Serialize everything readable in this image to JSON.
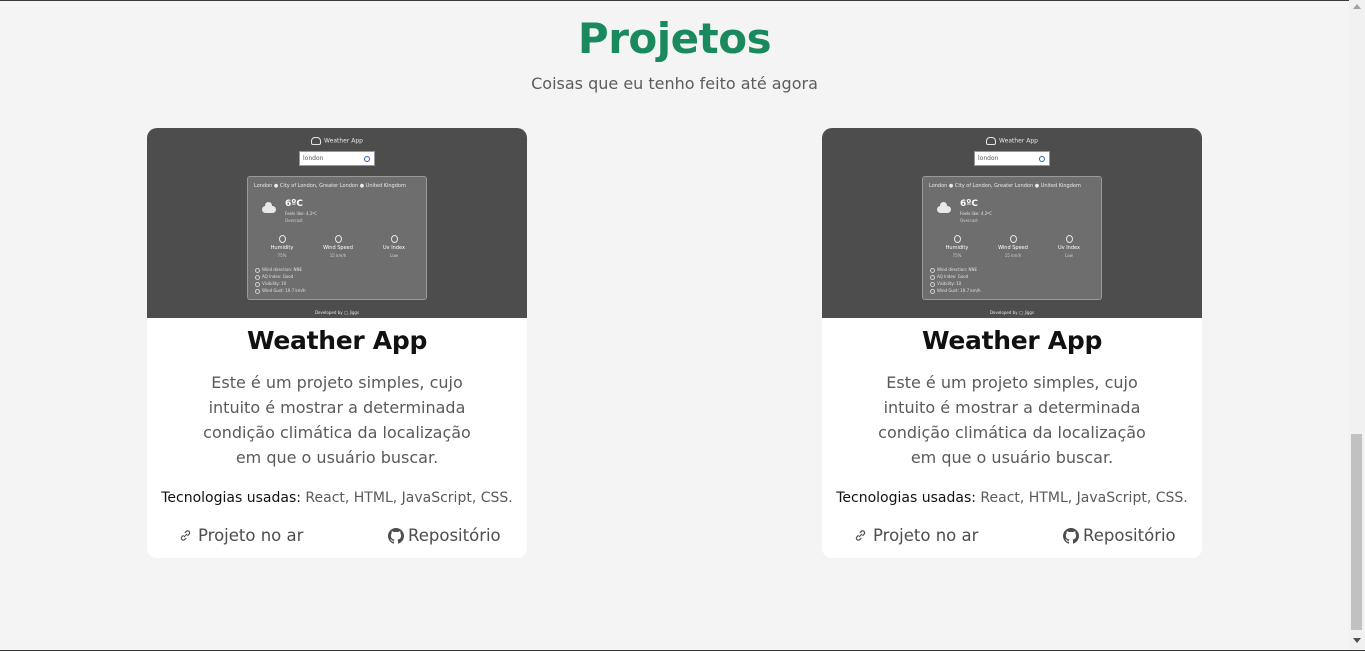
{
  "section": {
    "title": "Projetos",
    "subtitle": "Coisas que eu tenho feito até agora"
  },
  "projects": [
    {
      "preview": {
        "app_title": "Weather App",
        "search_value": "london",
        "location": "London ● City of London, Greater London ● United Kingdom",
        "temperature": "6ºC",
        "feels_like": "Feels like: 4.2ºC",
        "condition": "Overcast",
        "stats": [
          {
            "label": "Humidity",
            "value": "75%"
          },
          {
            "label": "Wind Speed",
            "value": "15 km/h"
          },
          {
            "label": "Uv Index",
            "value": "Low"
          }
        ],
        "details": [
          "Wind direction: NNE",
          "AQ Index: Good",
          "Visibility: 10",
          "Wind Gust: 19.7 km/h"
        ],
        "footer": "Developed by ◯ Jiggs"
      },
      "title": "Weather App",
      "description": "Este é um projeto simples, cujo intuito é mostrar a determinada condição climática da localização em que o usuário buscar.",
      "tech_label": "Tecnologias usadas:",
      "tech_list": "React, HTML, JavaScript, CSS.",
      "live_label": "Projeto no ar",
      "repo_label": "Repositório"
    },
    {
      "preview": {
        "app_title": "Weather App",
        "search_value": "london",
        "location": "London ● City of London, Greater London ● United Kingdom",
        "temperature": "6ºC",
        "feels_like": "Feels like: 4.2ºC",
        "condition": "Overcast",
        "stats": [
          {
            "label": "Humidity",
            "value": "75%"
          },
          {
            "label": "Wind Speed",
            "value": "15 km/h"
          },
          {
            "label": "Uv Index",
            "value": "Low"
          }
        ],
        "details": [
          "Wind direction: NNE",
          "AQ Index: Good",
          "Visibility: 10",
          "Wind Gust: 19.7 km/h"
        ],
        "footer": "Developed by ◯ Jiggs"
      },
      "title": "Weather App",
      "description": "Este é um projeto simples, cujo intuito é mostrar a determinada condição climática da localização em que o usuário buscar.",
      "tech_label": "Tecnologias usadas:",
      "tech_list": "React, HTML, JavaScript, CSS.",
      "live_label": "Projeto no ar",
      "repo_label": "Repositório"
    }
  ],
  "colors": {
    "accent": "#1a8a5e",
    "background": "#f4f4f4",
    "card": "#ffffff",
    "preview_bg": "#4d4d4d"
  },
  "icons": {
    "live_link": "link-icon",
    "repo_link": "github-icon"
  }
}
